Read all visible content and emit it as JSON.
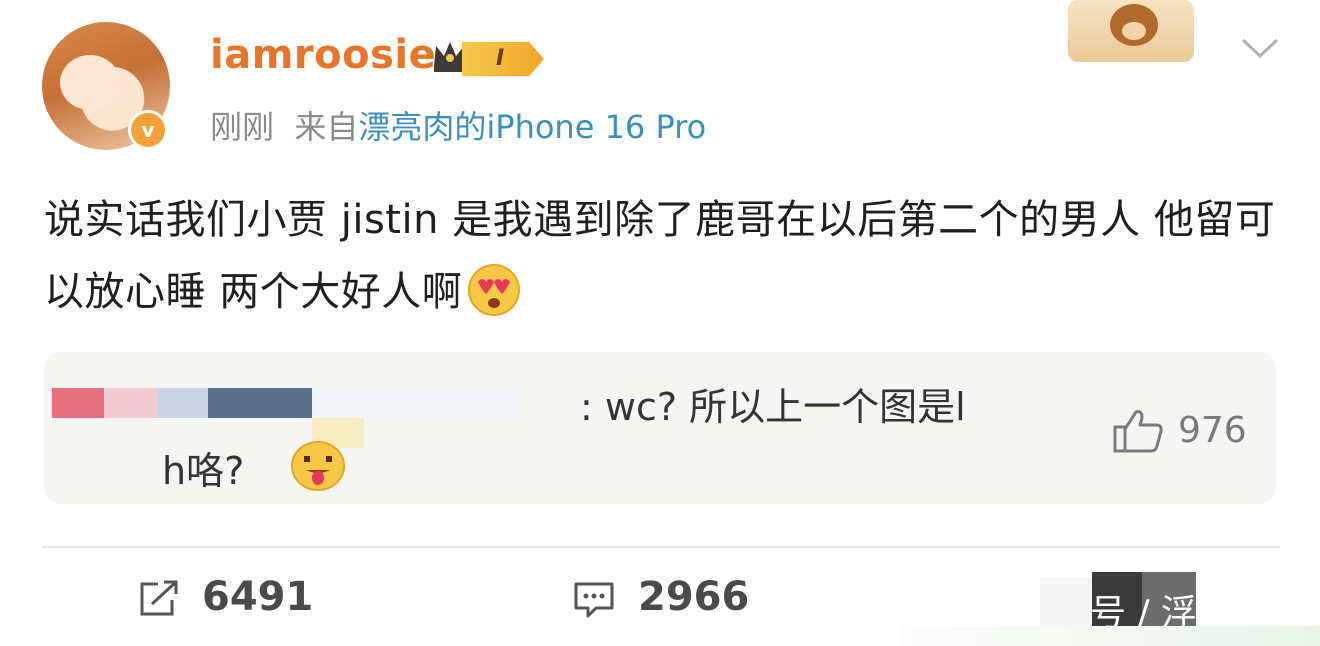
{
  "post": {
    "username": "iamroosie",
    "level_badge": "I",
    "time": "刚刚",
    "source_prefix": "来自",
    "source_device": "漂亮肉的iPhone 16 Pro",
    "text": "说实话我们小贾 jistin 是我遇到除了鹿哥在以后第二个的男人 他留可以放心睡 两个大好人啊"
  },
  "comment": {
    "line1": ": wc?  所以上一个图是l",
    "line2": "h咯?",
    "likes": "976"
  },
  "actions": {
    "share_count": "6491",
    "comment_count": "2966"
  },
  "watermark": {
    "text": "号 / 浮"
  },
  "colors": {
    "username": "#e8742a",
    "source_link": "#3d8fbd",
    "muted": "#8a8a8a",
    "verified_badge": "#f5a13a"
  },
  "icons": [
    "verified-icon",
    "crown-icon",
    "chevron-down-icon",
    "heart-eyes-emoji-icon",
    "tongue-emoji-icon",
    "thumbs-up-icon",
    "share-icon",
    "comment-icon"
  ]
}
